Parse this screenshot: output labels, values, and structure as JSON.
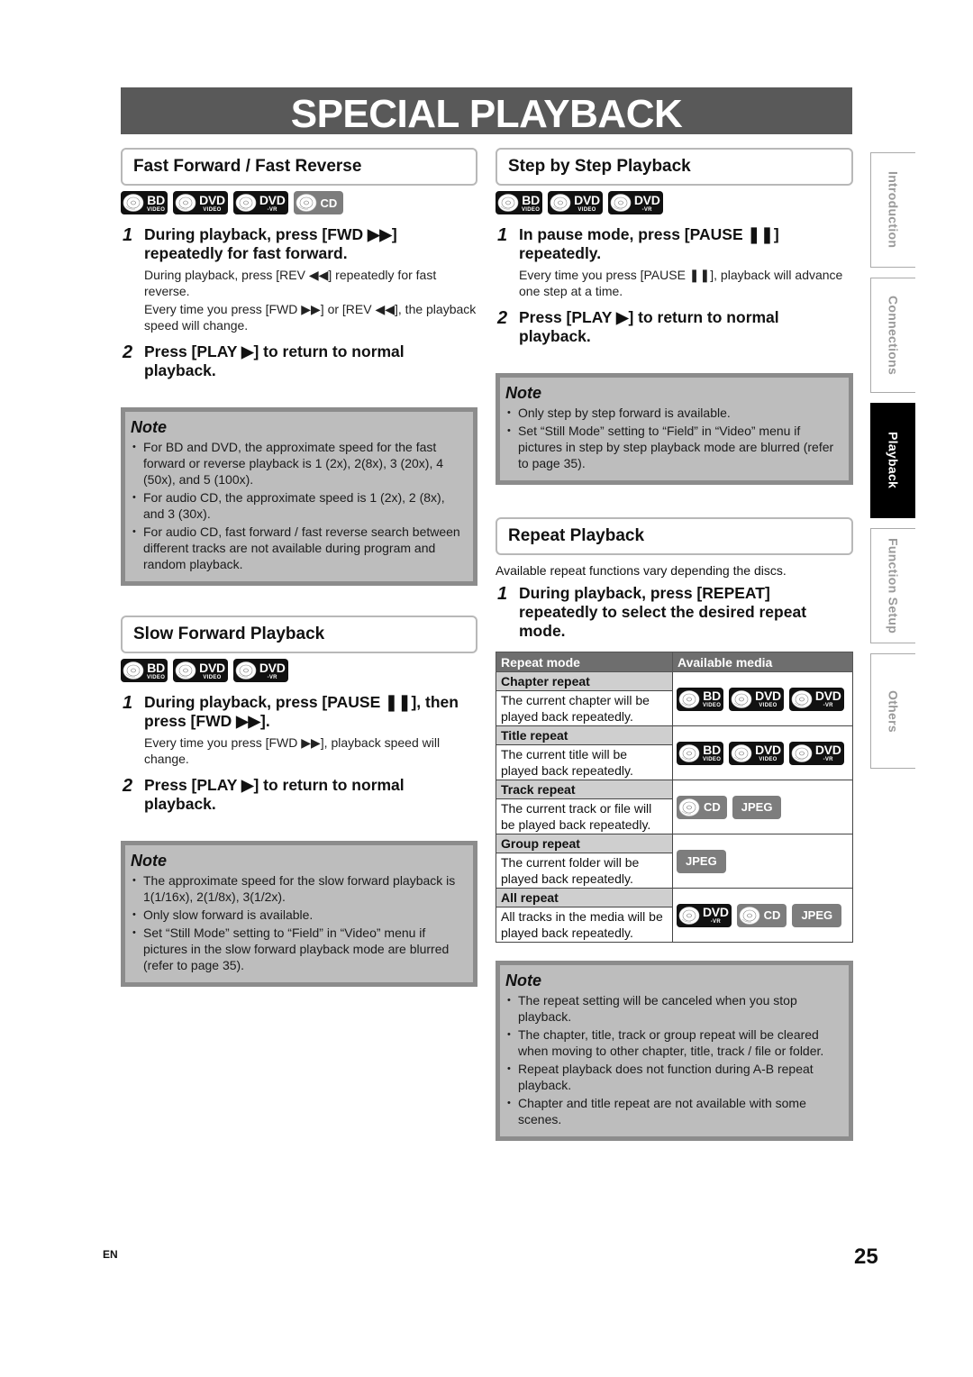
{
  "page": {
    "title": "SPECIAL PLAYBACK",
    "footer_lang": "EN",
    "page_number": "25"
  },
  "side_tabs": [
    {
      "label": "Introduction",
      "active": false
    },
    {
      "label": "Connections",
      "active": false
    },
    {
      "label": "Playback",
      "active": true
    },
    {
      "label": "Function Setup",
      "active": false
    },
    {
      "label": "Others",
      "active": false
    }
  ],
  "badges": {
    "bd": {
      "big": "BD",
      "small": "VIDEO"
    },
    "dvd_video": {
      "big": "DVD",
      "small": "VIDEO"
    },
    "dvd_vr": {
      "big": "DVD",
      "small": "-VR"
    },
    "cd": {
      "label": "CD"
    },
    "jpeg": {
      "label": "JPEG"
    }
  },
  "fast": {
    "title": "Fast Forward / Fast Reverse",
    "steps": [
      {
        "num": "1",
        "head": "During playback, press [FWD ▶▶] repeatedly for fast forward.",
        "body": [
          "During playback, press [REV ◀◀] repeatedly for fast reverse.",
          "Every time you press [FWD ▶▶] or [REV ◀◀], the playback speed will change."
        ]
      },
      {
        "num": "2",
        "head": "Press [PLAY ▶] to return to normal playback."
      }
    ],
    "note": {
      "title": "Note",
      "items": [
        "For BD and DVD, the approximate speed for the fast forward or reverse playback is 1 (2x), 2(8x), 3 (20x), 4 (50x), and 5 (100x).",
        "For audio CD, the approximate speed is 1 (2x), 2 (8x), and 3 (30x).",
        "For audio CD, fast forward / fast reverse search between different tracks are not available during program and random playback."
      ]
    }
  },
  "slow": {
    "title": "Slow Forward Playback",
    "steps": [
      {
        "num": "1",
        "head": "During playback, press [PAUSE ❚❚], then press [FWD ▶▶].",
        "body": [
          "Every time you press [FWD ▶▶], playback speed will change."
        ]
      },
      {
        "num": "2",
        "head": "Press [PLAY ▶] to return to normal playback."
      }
    ],
    "note": {
      "title": "Note",
      "items": [
        "The approximate speed for the slow forward playback is 1(1/16x), 2(1/8x), 3(1/2x).",
        "Only slow forward is available.",
        "Set “Still Mode” setting to “Field” in “Video” menu if pictures in the slow forward playback mode are blurred (refer to page 35)."
      ]
    }
  },
  "step": {
    "title": "Step by Step Playback",
    "steps": [
      {
        "num": "1",
        "head": "In pause mode, press [PAUSE ❚❚] repeatedly.",
        "body": [
          "Every time you press [PAUSE ❚❚], playback will advance one step at a time."
        ]
      },
      {
        "num": "2",
        "head": "Press [PLAY ▶] to return to normal playback."
      }
    ],
    "note": {
      "title": "Note",
      "items": [
        "Only step by step forward is available.",
        "Set “Still Mode” setting to “Field” in “Video” menu if pictures in step by step playback mode are blurred (refer to page 35)."
      ]
    }
  },
  "repeat": {
    "title": "Repeat Playback",
    "intro": "Available repeat functions vary depending the discs.",
    "steps": [
      {
        "num": "1",
        "head": "During playback, press [REPEAT] repeatedly to select the desired repeat mode."
      }
    ],
    "table": {
      "headers": [
        "Repeat mode",
        "Available media"
      ],
      "rows": [
        {
          "mode": "Chapter repeat",
          "desc": "The current chapter will be played back repeatedly.",
          "media": [
            "BD VIDEO",
            "DVD VIDEO",
            "DVD -VR"
          ]
        },
        {
          "mode": "Title repeat",
          "desc": "The current title will be played back repeatedly.",
          "media": [
            "BD VIDEO",
            "DVD VIDEO",
            "DVD -VR"
          ]
        },
        {
          "mode": "Track repeat",
          "desc": "The current track or file will be played back repeatedly.",
          "media": [
            "CD",
            "JPEG"
          ]
        },
        {
          "mode": "Group repeat",
          "desc": "The current folder will be played back repeatedly.",
          "media": [
            "JPEG"
          ]
        },
        {
          "mode": "All repeat",
          "desc": "All tracks in the media will be played back repeatedly.",
          "media": [
            "DVD -VR",
            "CD",
            "JPEG"
          ]
        }
      ]
    },
    "note": {
      "title": "Note",
      "items": [
        "The repeat setting will be canceled when you stop playback.",
        "The chapter, title, track or group repeat will be cleared when moving to other chapter, title, track / file or folder.",
        "Repeat playback does not function during A-B repeat playback.",
        "Chapter and title repeat are not available with some scenes."
      ]
    }
  }
}
